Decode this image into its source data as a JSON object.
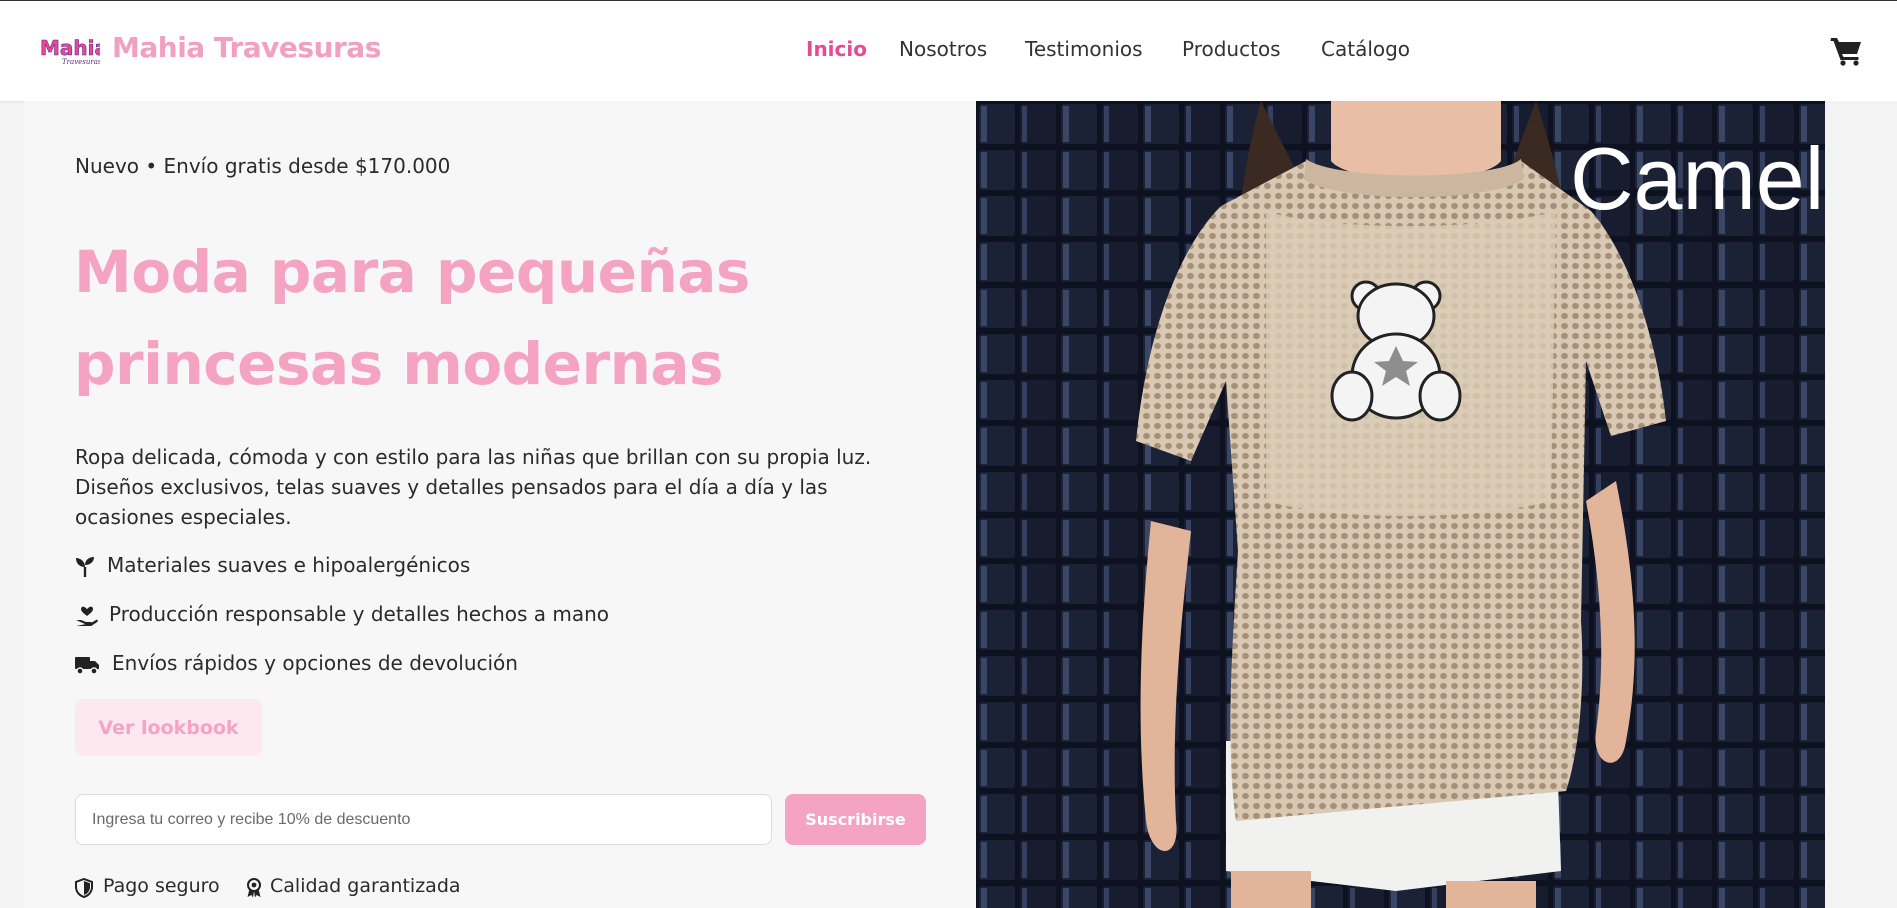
{
  "header": {
    "logo_text": "Mahia",
    "logo_subtext": "Travesuras",
    "brand": "Mahia Travesuras",
    "nav": [
      {
        "label": "Inicio",
        "active": true
      },
      {
        "label": "Nosotros",
        "active": false
      },
      {
        "label": "Testimonios",
        "active": false
      },
      {
        "label": "Productos",
        "active": false
      },
      {
        "label": "Catálogo",
        "active": false
      }
    ],
    "cart_icon": "shopping-cart-icon"
  },
  "hero": {
    "tagline": "Nuevo • Envío gratis desde $170.000",
    "title_line1": "Moda para pequeñas",
    "title_line2": "princesas modernas",
    "description": "Ropa delicada, cómoda y con estilo para las niñas que brillan con su propia luz. Diseños exclusivos, telas suaves y detalles pensados para el día a día y las ocasiones especiales.",
    "features": [
      {
        "icon": "seedling-icon",
        "label": "Materiales suaves e hipoalergénicos"
      },
      {
        "icon": "hand-heart-icon",
        "label": "Producción responsable y detalles hechos a mano"
      },
      {
        "icon": "truck-icon",
        "label": "Envíos rápidos y opciones de devolución"
      }
    ],
    "lookbook_button": "Ver lookbook",
    "email_placeholder": "Ingresa tu correo y recibe 10% de descuento",
    "subscribe_button": "Suscribirse",
    "trust": [
      {
        "icon": "shield-icon",
        "label": "Pago seguro"
      },
      {
        "icon": "award-icon",
        "label": "Calidad garantizada"
      }
    ]
  },
  "image": {
    "caption": "Camel"
  },
  "colors": {
    "accent": "#e64a95",
    "pink": "#f5a3c2",
    "pink_light": "#fde8ef",
    "text": "#2b2b2b"
  }
}
